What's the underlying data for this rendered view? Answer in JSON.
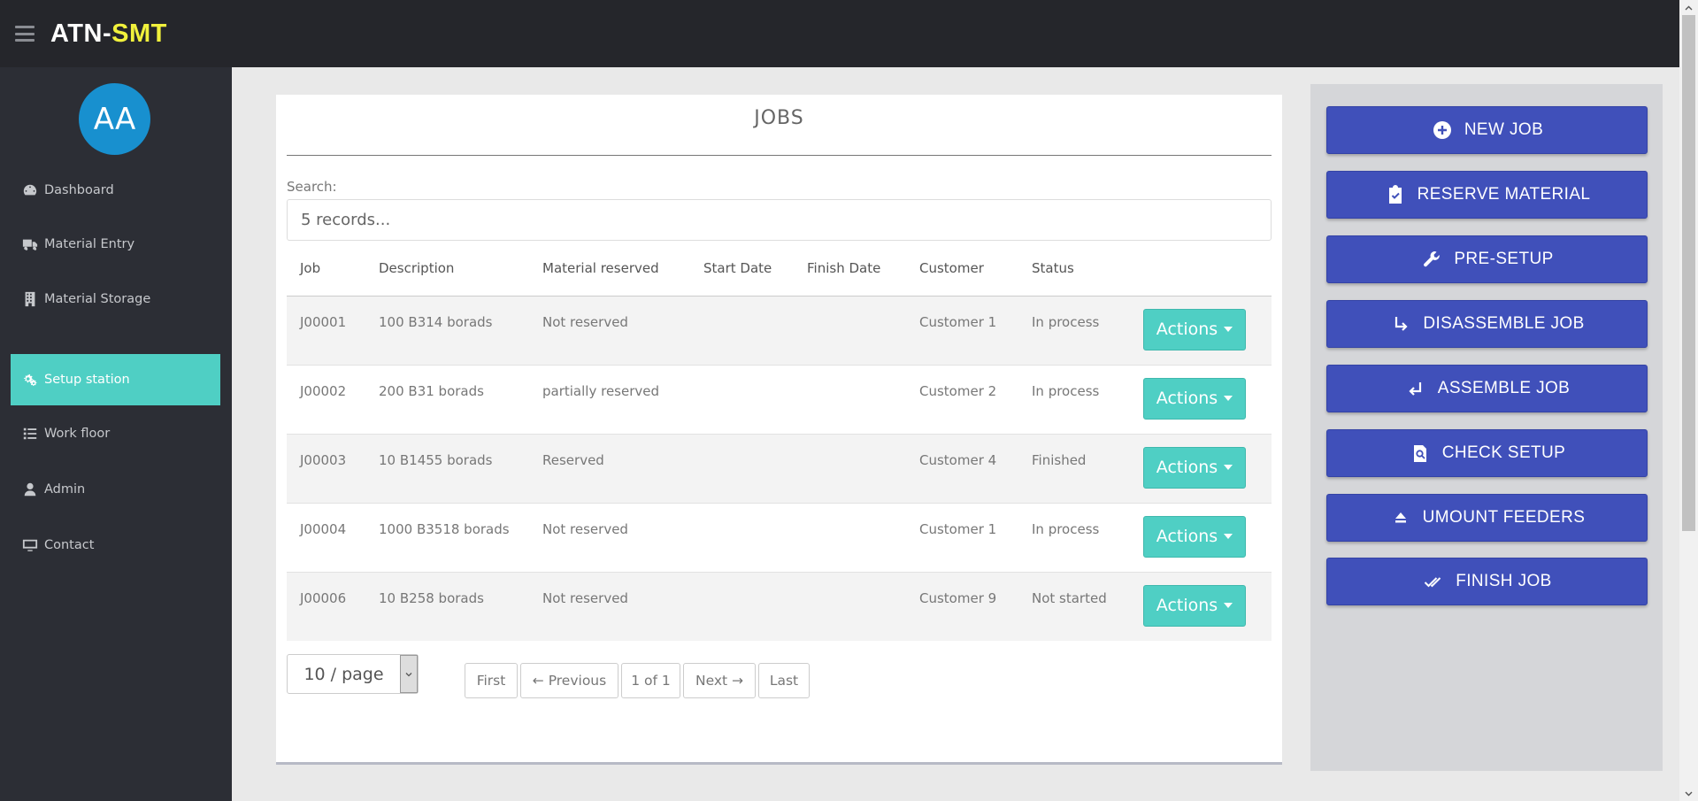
{
  "app": {
    "brand_part1": "ATN-",
    "brand_part2": "SMT"
  },
  "user": {
    "initials": "AA"
  },
  "sidebar": {
    "items": [
      {
        "label": "Dashboard",
        "icon": "tachometer-icon"
      },
      {
        "label": "Material Entry",
        "icon": "truck-icon"
      },
      {
        "label": "Material Storage",
        "icon": "building-icon"
      },
      {
        "label": "Setup station",
        "icon": "cogs-icon",
        "active": true
      },
      {
        "label": "Work floor",
        "icon": "list-icon"
      },
      {
        "label": "Admin",
        "icon": "user-icon"
      },
      {
        "label": "Contact",
        "icon": "desktop-icon"
      }
    ]
  },
  "jobs": {
    "title": "JOBS",
    "search_label": "Search:",
    "search_placeholder": "5 records...",
    "columns": [
      "Job",
      "Description",
      "Material reserved",
      "Start Date",
      "Finish Date",
      "Customer",
      "Status"
    ],
    "rows": [
      {
        "job": "J00001",
        "description": "100 B314 borads",
        "material": "Not reserved",
        "start": "",
        "finish": "",
        "customer": "Customer 1",
        "status": "In process",
        "action": "Actions"
      },
      {
        "job": "J00002",
        "description": "200 B31 borads",
        "material": "partially reserved",
        "start": "",
        "finish": "",
        "customer": "Customer 2",
        "status": "In process",
        "action": "Actions"
      },
      {
        "job": "J00003",
        "description": "10 B1455 borads",
        "material": "Reserved",
        "start": "",
        "finish": "",
        "customer": "Customer 4",
        "status": "Finished",
        "action": "Actions"
      },
      {
        "job": "J00004",
        "description": "1000 B3518 borads",
        "material": "Not reserved",
        "start": "",
        "finish": "",
        "customer": "Customer 1",
        "status": "In process",
        "action": "Actions"
      },
      {
        "job": "J00006",
        "description": "10 B258 borads",
        "material": "Not reserved",
        "start": "",
        "finish": "",
        "customer": "Customer 9",
        "status": "Not started",
        "action": "Actions"
      }
    ],
    "pagination": {
      "page_size": "10 / page",
      "first": "First",
      "previous": "← Previous",
      "current": "1 of 1",
      "next": "Next →",
      "last": "Last"
    }
  },
  "actions_panel": {
    "buttons": [
      {
        "label": "NEW JOB",
        "icon": "plus-circle-icon"
      },
      {
        "label": "RESERVE MATERIAL",
        "icon": "clipboard-check-icon"
      },
      {
        "label": "PRE-SETUP",
        "icon": "wrench-icon"
      },
      {
        "label": "DISASSEMBLE JOB",
        "icon": "arrow-down-right-icon"
      },
      {
        "label": "ASSEMBLE JOB",
        "icon": "enter-arrow-icon"
      },
      {
        "label": "CHECK SETUP",
        "icon": "document-search-icon"
      },
      {
        "label": "UMOUNT FEEDERS",
        "icon": "eject-icon"
      },
      {
        "label": "FINISH JOB",
        "icon": "double-check-icon"
      }
    ]
  },
  "colors": {
    "topbar": "#25262b",
    "sidebar": "#2c2e35",
    "accent_teal": "#4fcfc4",
    "action_blue": "#4050ba",
    "brand_yellow": "#f1f13c",
    "avatar_blue": "#1890cf"
  }
}
